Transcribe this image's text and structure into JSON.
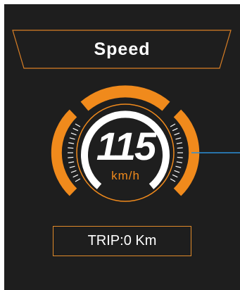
{
  "title": "Speed",
  "speed": {
    "value": "115",
    "unit": "km/h"
  },
  "trip": {
    "label": "TRIP:0 Km"
  },
  "colors": {
    "background": "#1e1e1e",
    "accent": "#f08a1c",
    "text": "#ffffff",
    "indicator_line": "#2b8fd8"
  }
}
